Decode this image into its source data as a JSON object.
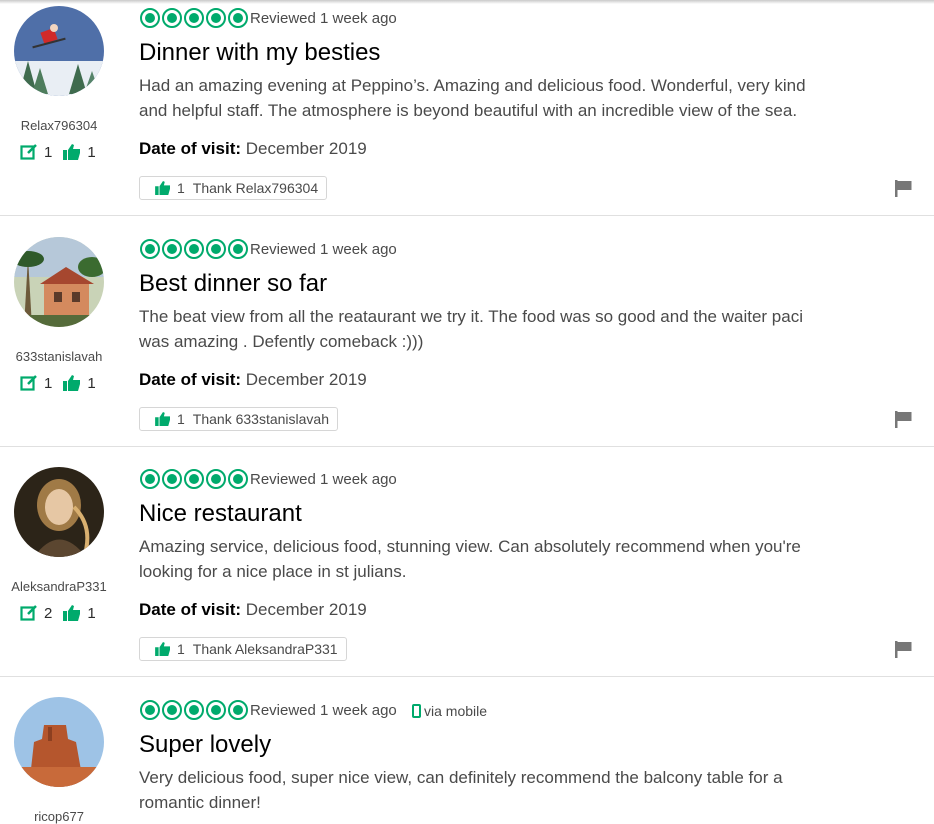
{
  "reviews": [
    {
      "username": "Relax796304",
      "contributions": "1",
      "helpful_votes": "1",
      "rating_bubbles": 5,
      "reviewed": "Reviewed 1 week ago",
      "via": "",
      "title": "Dinner with my besties",
      "text_lines": [
        "Had an amazing evening at Peppino’s. Amazing and delicious food. Wonderful, very kind",
        "and helpful staff. The atmosphere is beyond beautiful with an incredible view of the sea."
      ],
      "date_label": "Date of visit:",
      "date_value": "December 2019",
      "thank_count": "1",
      "thank_label": "Thank Relax796304"
    },
    {
      "username": "633stanislavah",
      "contributions": "1",
      "helpful_votes": "1",
      "rating_bubbles": 5,
      "reviewed": "Reviewed 1 week ago",
      "via": "",
      "title": "Best dinner so far",
      "text_lines": [
        "The beat view from all the reataurant we try it. The food was so good and the waiter paci",
        "was amazing . Defently comeback :)))"
      ],
      "date_label": "Date of visit:",
      "date_value": "December 2019",
      "thank_count": "1",
      "thank_label": "Thank 633stanislavah"
    },
    {
      "username": "AleksandraP331",
      "contributions": "2",
      "helpful_votes": "1",
      "rating_bubbles": 5,
      "reviewed": "Reviewed 1 week ago",
      "via": "",
      "title": "Nice restaurant",
      "text_lines": [
        "Amazing service, delicious food, stunning view. Can absolutely recommend when you're",
        "looking for a nice place in st julians."
      ],
      "date_label": "Date of visit:",
      "date_value": "December 2019",
      "thank_count": "1",
      "thank_label": "Thank AleksandraP331"
    },
    {
      "username": "ricop677",
      "rating_bubbles": 5,
      "reviewed": "Reviewed 1 week ago",
      "via": "via mobile",
      "title": "Super lovely",
      "text_lines": [
        "Very delicious food, super nice view, can definitely recommend the balcony table for a",
        "romantic dinner!"
      ]
    }
  ],
  "colors": {
    "accent": "#00aa6c",
    "text": "#4a4a4a",
    "title": "#000000",
    "flag": "#777777"
  },
  "icons": {
    "contrib": "edit-review-icon",
    "helpful": "thumbs-up-icon",
    "report": "flag-icon",
    "mobile": "mobile-phone-icon"
  }
}
